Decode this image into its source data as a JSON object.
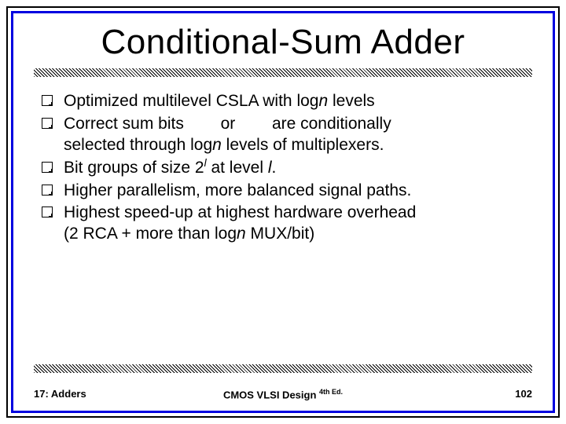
{
  "title": "Conditional-Sum Adder",
  "bullets": {
    "b1": {
      "pre": "Optimized multilevel CSLA with log",
      "n1": "n",
      "post": " levels"
    },
    "b2": {
      "l1a": "Correct sum bits",
      "or": "or",
      "l1b": "are conditionally",
      "l2a": "selected through log",
      "n": "n",
      "l2b": " levels of multiplexers."
    },
    "b3": {
      "pre": "Bit groups of size 2",
      "sup": "l",
      "mid": " at level ",
      "l": "l",
      "post": "."
    },
    "b4": "Higher parallelism, more balanced signal paths.",
    "b5": {
      "l1": "Highest speed-up at highest hardware overhead",
      "l2a": "(2 RCA + more than log",
      "n": "n",
      "l2b": " MUX/bit)"
    }
  },
  "footer": {
    "left": "17: Adders",
    "center": "CMOS VLSI Design",
    "edition": "4th Ed.",
    "page": "102"
  }
}
